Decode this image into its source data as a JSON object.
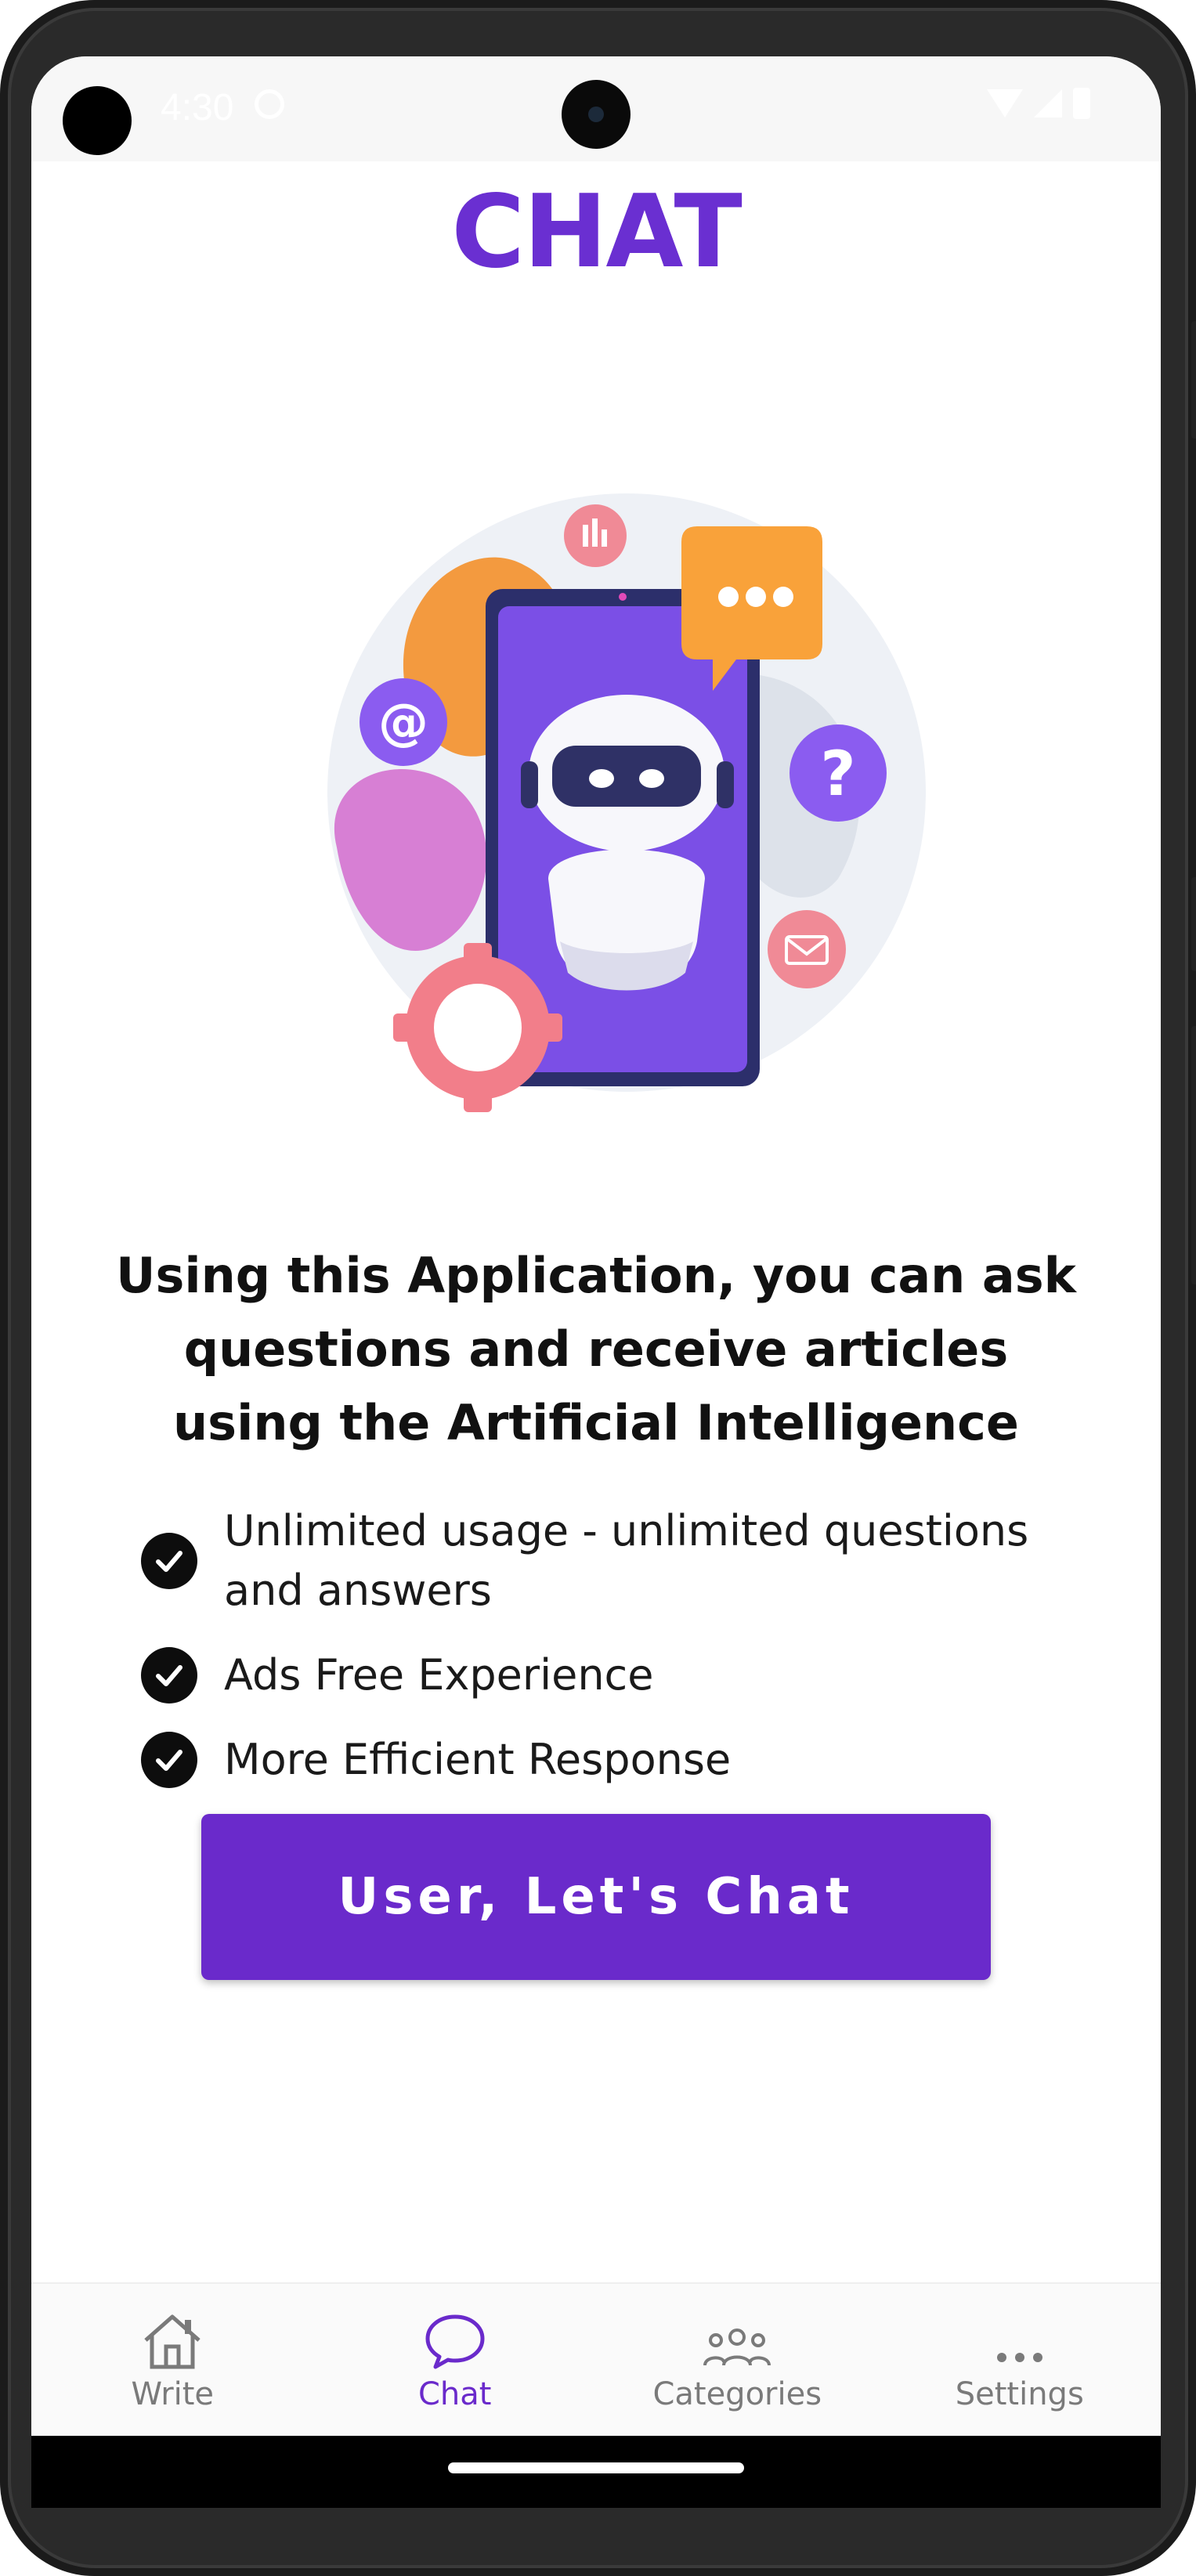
{
  "status_bar": {
    "time": "4:30"
  },
  "page": {
    "title": "CHAT"
  },
  "headline": "Using this Application, you can ask questions and receive articles using the Artificial Intelligence",
  "features": [
    "Unlimited usage - unlimited questions and answers",
    "Ads Free Experience",
    "More Efficient Response"
  ],
  "cta_label": "User, Let's Chat",
  "bottom_nav": {
    "items": [
      {
        "label": "Write",
        "icon": "home-icon",
        "active": false
      },
      {
        "label": "Chat",
        "icon": "chat-bubble-icon",
        "active": true
      },
      {
        "label": "Categories",
        "icon": "people-icon",
        "active": false
      },
      {
        "label": "Settings",
        "icon": "more-dots-icon",
        "active": false
      }
    ]
  },
  "colors": {
    "accent": "#6a2acb",
    "title": "#6a2fd1",
    "nav_inactive": "#7a7a7a"
  }
}
